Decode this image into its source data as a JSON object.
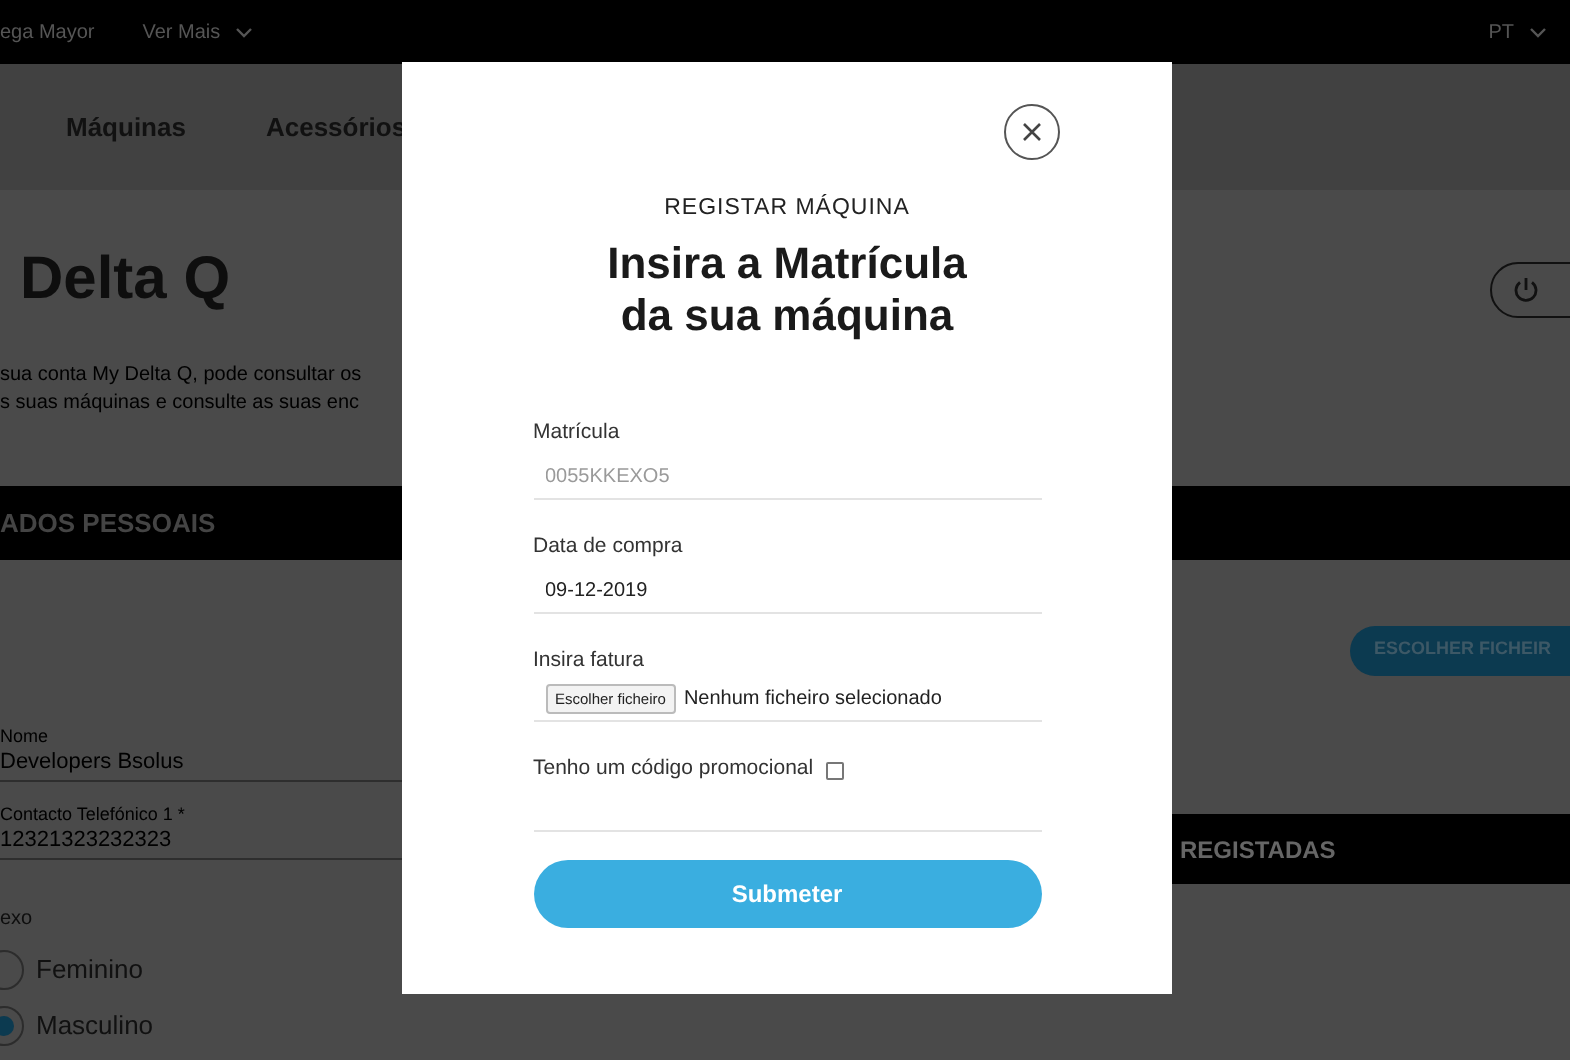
{
  "top_bar": {
    "left": [
      {
        "label": "ega Mayor",
        "dropdown": false
      },
      {
        "label": "Ver Mais",
        "dropdown": true
      }
    ],
    "right": [
      {
        "label": "PT",
        "dropdown": true
      }
    ]
  },
  "nav": {
    "items": [
      "Máquinas",
      "Acessórios"
    ]
  },
  "hero": {
    "title": "Delta Q",
    "text_lines": [
      "sua conta My Delta Q, pode consultar os",
      "s suas máquinas e consulte as suas enc"
    ]
  },
  "personal_section": {
    "heading": "ADOS PESSOAIS",
    "fields": [
      {
        "label": "Nome",
        "value": "Developers Bsolus"
      },
      {
        "label": "Contacto Telefónico 1 *",
        "value": "12321323232323"
      }
    ],
    "gender": {
      "label": "exo",
      "options": [
        {
          "label": "Feminino",
          "selected": false
        },
        {
          "label": "Masculino",
          "selected": true
        }
      ]
    }
  },
  "right_section": {
    "file_button": "ESCOLHER FICHEIR",
    "machines_heading": "REGISTADAS"
  },
  "modal": {
    "eyebrow": "REGISTAR MÁQUINA",
    "title_lines": [
      "Insira a Matrícula",
      "da sua máquina"
    ],
    "fields": [
      {
        "kind": "text",
        "label": "Matrícula",
        "value": "0055KKEXO5",
        "disabled": true
      },
      {
        "kind": "text",
        "label": "Data de compra",
        "value": "09-12-2019",
        "disabled": false
      },
      {
        "kind": "file",
        "label": "Insira fatura",
        "button": "Escolher ficheiro",
        "status": "Nenhum ficheiro selecionado"
      }
    ],
    "promo": {
      "label": "Tenho um código promocional",
      "checked": false
    },
    "submit": "Submeter"
  }
}
